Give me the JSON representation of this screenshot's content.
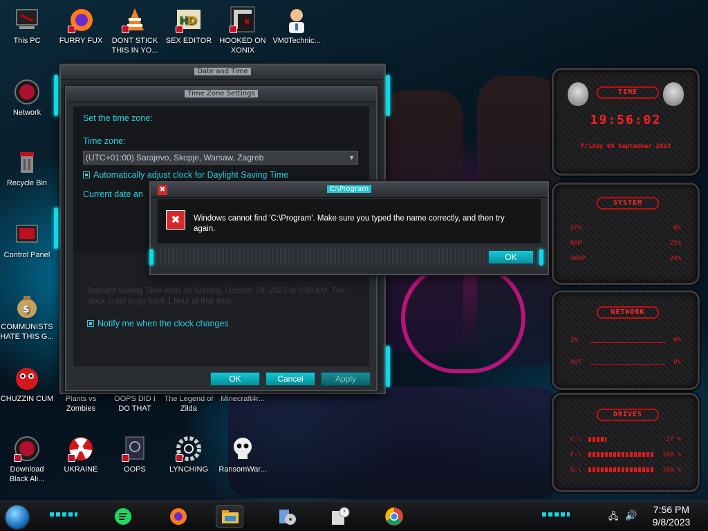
{
  "desktop_icons": [
    {
      "name": "this-pc",
      "label": "This PC"
    },
    {
      "name": "furry-fux",
      "label": "FURRY FUX"
    },
    {
      "name": "dont-stick",
      "label": "DONT STICK THIS IN YO..."
    },
    {
      "name": "sex-editor",
      "label": "SEX EDITOR"
    },
    {
      "name": "hooked-on-xonix",
      "label": "HOOKED ON XONIX"
    },
    {
      "name": "vm0technic",
      "label": "VM0Technic..."
    },
    {
      "name": "network",
      "label": "Network"
    },
    {
      "name": "recycle-bin",
      "label": "Recycle Bin"
    },
    {
      "name": "control-panel",
      "label": "Control Panel"
    },
    {
      "name": "communists",
      "label": "COMMUNISTS HATE THIS G..."
    },
    {
      "name": "chuzzin-cum",
      "label": "CHUZZIN CUM"
    },
    {
      "name": "plants-vs-zombies",
      "label": "Plants vs Zombies"
    },
    {
      "name": "oops-did-i",
      "label": "OOPS DID I DO THAT"
    },
    {
      "name": "legend-of-zilda",
      "label": "The Legend of Zilda"
    },
    {
      "name": "minecraft4",
      "label": "Minecraft4r..."
    },
    {
      "name": "download-black-ali",
      "label": "Download Black Ali..."
    },
    {
      "name": "ukraine",
      "label": "UKRAINE"
    },
    {
      "name": "oops",
      "label": "OOPS"
    },
    {
      "name": "lynching",
      "label": "LYNCHING"
    },
    {
      "name": "ransomwar",
      "label": "RansomWar..."
    }
  ],
  "date_time_window": {
    "title": "Date and Time"
  },
  "tz_dialog": {
    "title": "Time Zone Settings",
    "heading": "Set the time zone:",
    "tz_label": "Time zone:",
    "tz_value": "(UTC+01:00) Sarajevo, Skopje, Warsaw, Zagreb",
    "dst_checkbox": "Automatically adjust clock for Daylight Saving Time",
    "current_label": "Current date an",
    "dst_info": "Daylight Saving Time ends on Sunday, October 29, 2023 at 3:00 AM. The clock is set to go back 1 hour at that time.",
    "notify_checkbox": "Notify me when the clock changes",
    "ok": "OK",
    "cancel": "Cancel",
    "apply": "Apply"
  },
  "error_dialog": {
    "title": "C:\\Program",
    "message": "Windows cannot find 'C:\\Program'. Make sure you typed the name correctly, and then try again.",
    "ok": "OK"
  },
  "gadgets": {
    "time": {
      "header": "TIME",
      "clock": "19:56:02",
      "date": "Friday 08 September 2023"
    },
    "system": {
      "header": "SYSTEM",
      "cpu_label": "CPU",
      "cpu": "8%",
      "ram_label": "RAM",
      "ram": "25%",
      "swap_label": "SWAP",
      "swap": "29%"
    },
    "network": {
      "header": "NETWORK",
      "in_label": "IN",
      "in": "0%",
      "out_label": "OUT",
      "out": "0%"
    },
    "drives": {
      "header": "DRIVES",
      "d1_label": "C:\\",
      "d1": "27 %",
      "d2_label": "F:\\",
      "d2": "100 %",
      "d3_label": "G:\\",
      "d3": "100 %"
    }
  },
  "taskbar": {
    "time": "7:56 PM",
    "date": "9/8/2023",
    "items": [
      "start-orb",
      "spotify",
      "firefox",
      "file-explorer",
      "media-disc",
      "calculator-clock",
      "chrome"
    ]
  },
  "colors": {
    "accent_cyan": "#0ed9e8",
    "gadget_red": "#e01b1b",
    "error_red": "#d62a2a"
  }
}
